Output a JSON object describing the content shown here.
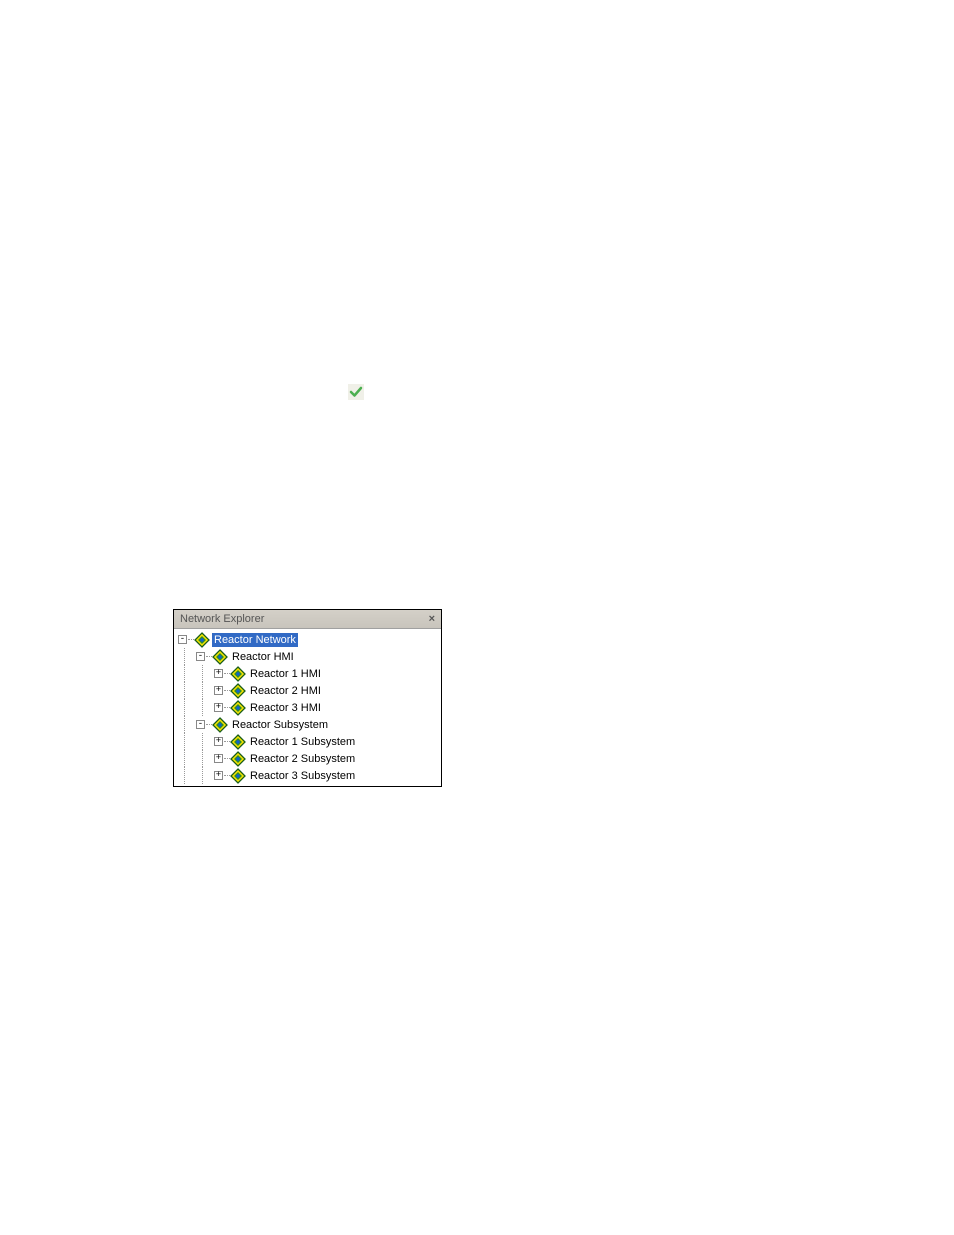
{
  "checkmark_name": "checkmark-icon",
  "panel": {
    "title": "Network Explorer",
    "close": "×"
  },
  "tree": [
    {
      "depth": 0,
      "expander": "-",
      "icon": "diamond-icon",
      "label": "Reactor Network",
      "selected": true
    },
    {
      "depth": 1,
      "expander": "-",
      "icon": "diamond-icon",
      "label": "Reactor HMI",
      "selected": false
    },
    {
      "depth": 2,
      "expander": "+",
      "icon": "diamond-icon",
      "label": "Reactor 1 HMI",
      "selected": false
    },
    {
      "depth": 2,
      "expander": "+",
      "icon": "diamond-icon",
      "label": "Reactor 2 HMI",
      "selected": false
    },
    {
      "depth": 2,
      "expander": "+",
      "icon": "diamond-icon",
      "label": "Reactor 3 HMI",
      "selected": false
    },
    {
      "depth": 1,
      "expander": "-",
      "icon": "diamond-icon",
      "label": "Reactor Subsystem",
      "selected": false
    },
    {
      "depth": 2,
      "expander": "+",
      "icon": "diamond-icon",
      "label": "Reactor 1 Subsystem",
      "selected": false
    },
    {
      "depth": 2,
      "expander": "+",
      "icon": "diamond-icon",
      "label": "Reactor 2 Subsystem",
      "selected": false
    },
    {
      "depth": 2,
      "expander": "+",
      "icon": "diamond-icon",
      "label": "Reactor 3 Subsystem",
      "selected": false
    }
  ]
}
